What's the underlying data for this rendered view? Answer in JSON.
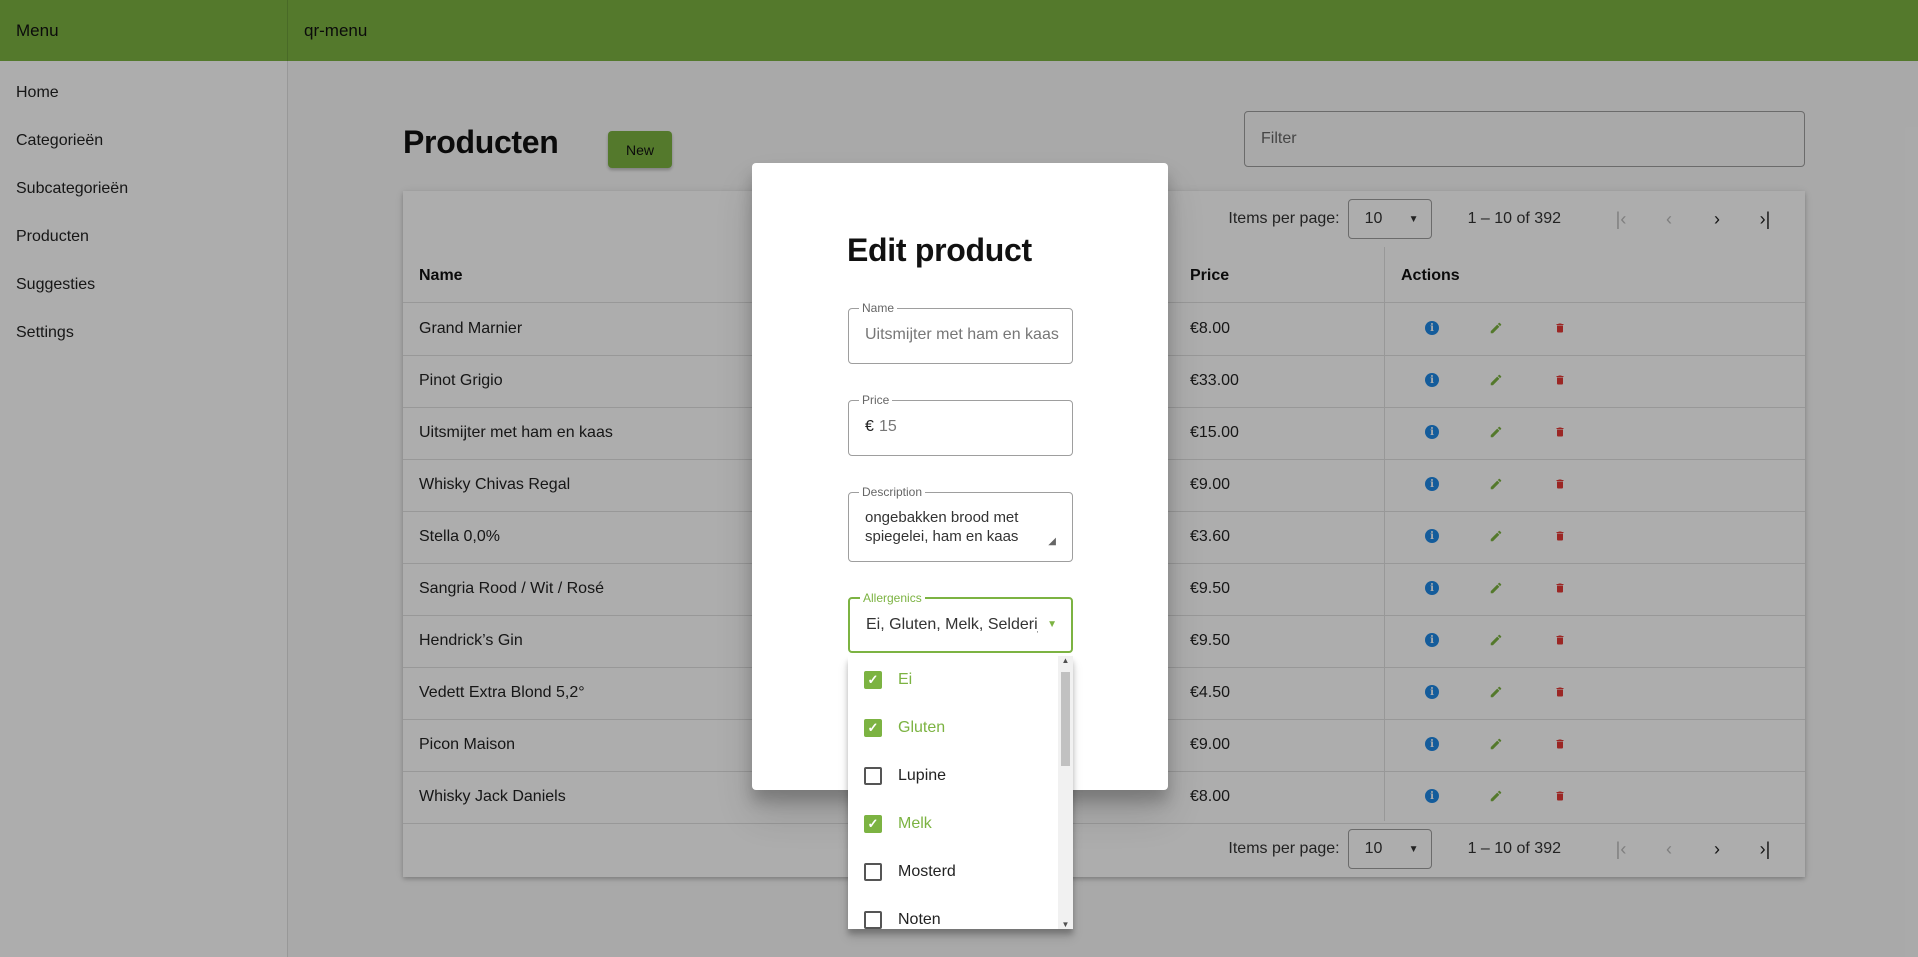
{
  "toolbar": {
    "menu_title": "Menu",
    "app_title": "qr-menu",
    "color": "#7cb342"
  },
  "sidebar": {
    "items": [
      {
        "label": "Home"
      },
      {
        "label": "Categorieën"
      },
      {
        "label": "Subcategorieën"
      },
      {
        "label": "Producten"
      },
      {
        "label": "Suggesties"
      },
      {
        "label": "Settings"
      }
    ]
  },
  "page": {
    "title": "Producten",
    "new_label": "New",
    "filter_placeholder": "Filter"
  },
  "paginator": {
    "items_per_page_label": "Items per page:",
    "page_size": "10",
    "range_label": "1 – 10 of 392"
  },
  "table": {
    "headers": {
      "name": "Name",
      "price": "Price",
      "actions": "Actions"
    },
    "rows": [
      {
        "name": "Grand Marnier",
        "price": "€8.00"
      },
      {
        "name": "Pinot Grigio",
        "price": "€33.00"
      },
      {
        "name": "Uitsmijter met ham en kaas",
        "price": "€15.00"
      },
      {
        "name": "Whisky Chivas Regal",
        "price": "€9.00"
      },
      {
        "name": "Stella 0,0%",
        "price": "€3.60"
      },
      {
        "name": "Sangria Rood / Wit / Rosé",
        "price": "€9.50"
      },
      {
        "name": "Hendrick’s Gin",
        "price": "€9.50"
      },
      {
        "name": "Vedett Extra Blond 5,2°",
        "price": "€4.50"
      },
      {
        "name": "Picon Maison",
        "price": "€9.00"
      },
      {
        "name": "Whisky Jack Daniels",
        "price": "€8.00"
      }
    ]
  },
  "dialog": {
    "title": "Edit product",
    "name_label": "Name",
    "name_value": "Uitsmijter met ham en kaas",
    "price_label": "Price",
    "price_prefix": "€",
    "price_value": "15",
    "description_label": "Description",
    "description_value": "ongebakken brood met spiegelei, ham en kaas",
    "allergenics_label": "Allergenics",
    "allergenics_value": "Ei, Gluten, Melk, Selderij"
  },
  "allergen_options": [
    {
      "label": "Ei",
      "checked": true
    },
    {
      "label": "Gluten",
      "checked": true
    },
    {
      "label": "Lupine",
      "checked": false
    },
    {
      "label": "Melk",
      "checked": true
    },
    {
      "label": "Mosterd",
      "checked": false
    },
    {
      "label": "Noten",
      "checked": false
    }
  ],
  "colors": {
    "accent": "#7cb342",
    "info": "#1e88e5",
    "edit": "#7cb342",
    "delete": "#e53935"
  },
  "icons": {
    "info": "info-icon",
    "edit": "pencil-icon",
    "delete": "trash-icon",
    "check": "check-icon"
  }
}
